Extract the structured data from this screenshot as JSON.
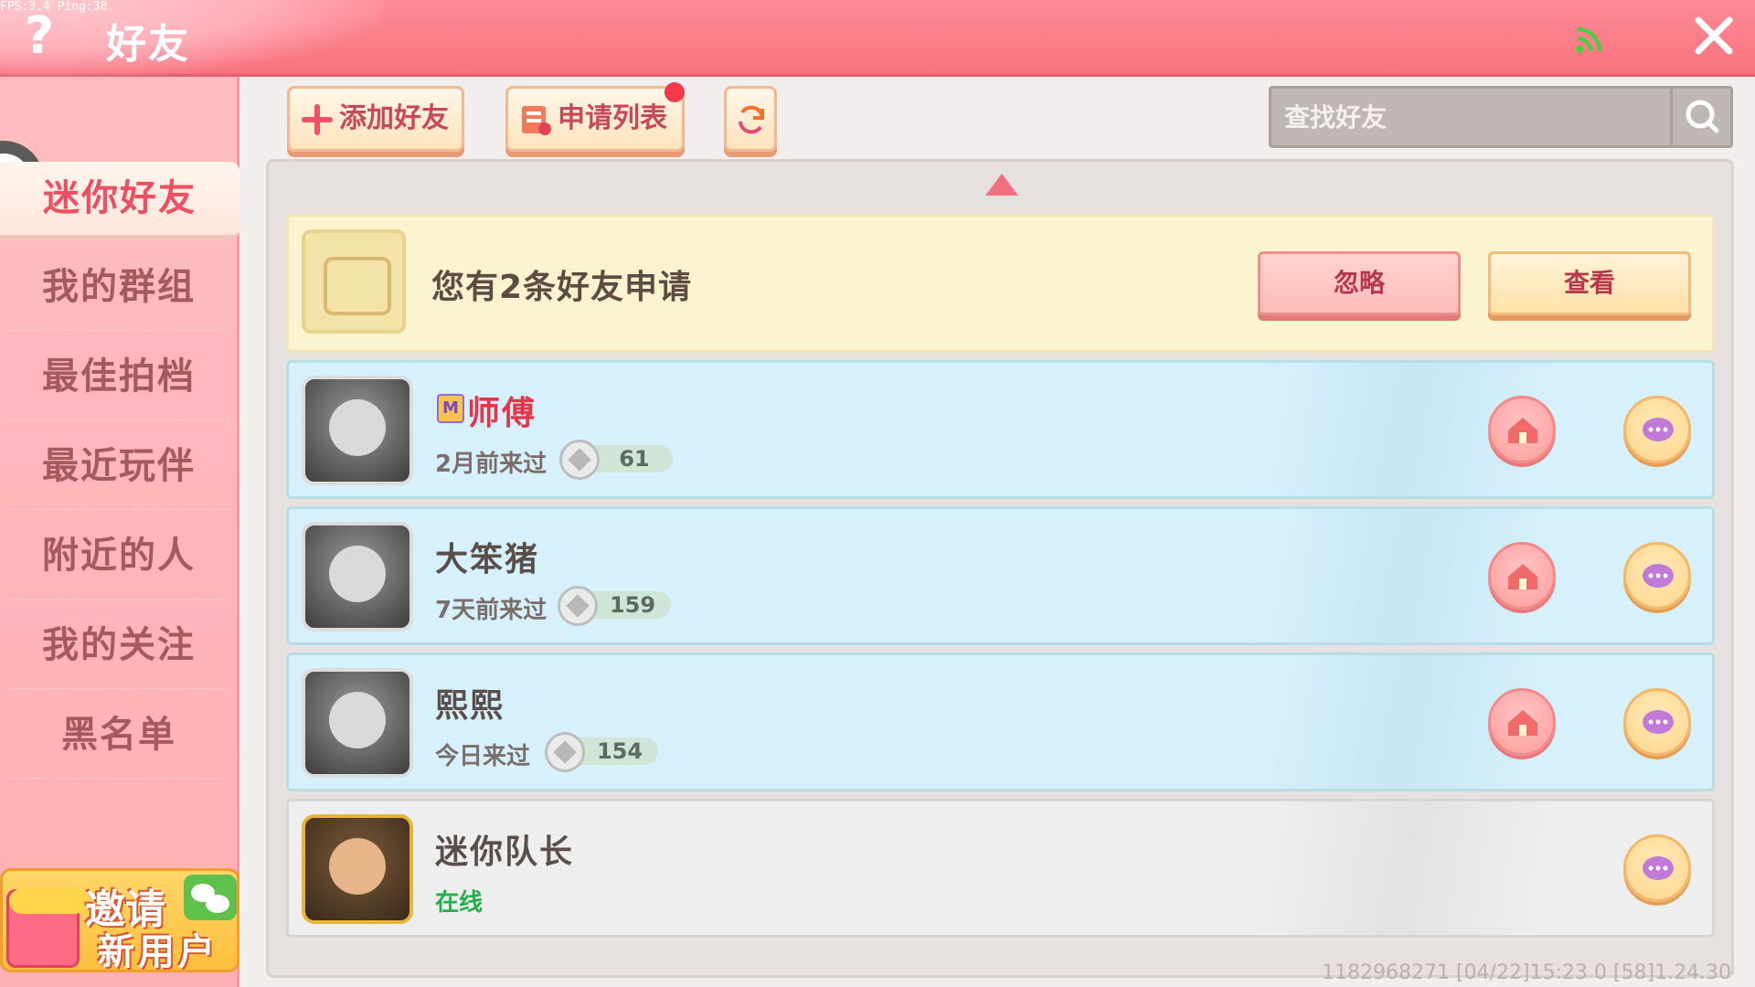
{
  "debug": {
    "fps_text": "FPS:3.4  Ping:38"
  },
  "header": {
    "title": "好友",
    "help_icon": "question-icon",
    "signal_icon": "signal-icon",
    "close_icon": "close-icon"
  },
  "colors": {
    "accent": "#f7727f",
    "active_tab_text": "#ef4f60",
    "online": "#23b04a",
    "master_name": "#e0364a"
  },
  "sidebar": {
    "items": [
      {
        "label": "迷你好友",
        "active": true
      },
      {
        "label": "我的群组",
        "active": false
      },
      {
        "label": "最佳拍档",
        "active": false
      },
      {
        "label": "最近玩伴",
        "active": false
      },
      {
        "label": "附近的人",
        "active": false
      },
      {
        "label": "我的关注",
        "active": false
      },
      {
        "label": "黑名单",
        "active": false
      }
    ],
    "invite": {
      "line1": "邀请",
      "line2": "新用户"
    }
  },
  "toolbar": {
    "add_friend": "添加好友",
    "request_list": "申请列表",
    "search_placeholder": "查找好友"
  },
  "friend_request": {
    "text": "您有2条好友申请",
    "ignore": "忽略",
    "view": "查看"
  },
  "friends": [
    {
      "name": "师傅",
      "status": "2月前来过",
      "level": "61",
      "online": false,
      "badge": "M"
    },
    {
      "name": "大笨猪",
      "status": "7天前来过",
      "level": "159",
      "online": false
    },
    {
      "name": "熙熙",
      "status": "今日来过",
      "level": "154",
      "online": false
    },
    {
      "name": "迷你队长",
      "status": "在线",
      "online": true
    }
  ],
  "footer": {
    "info": "1182968271    [04/22]15:23 0  [58]1.24.30"
  }
}
